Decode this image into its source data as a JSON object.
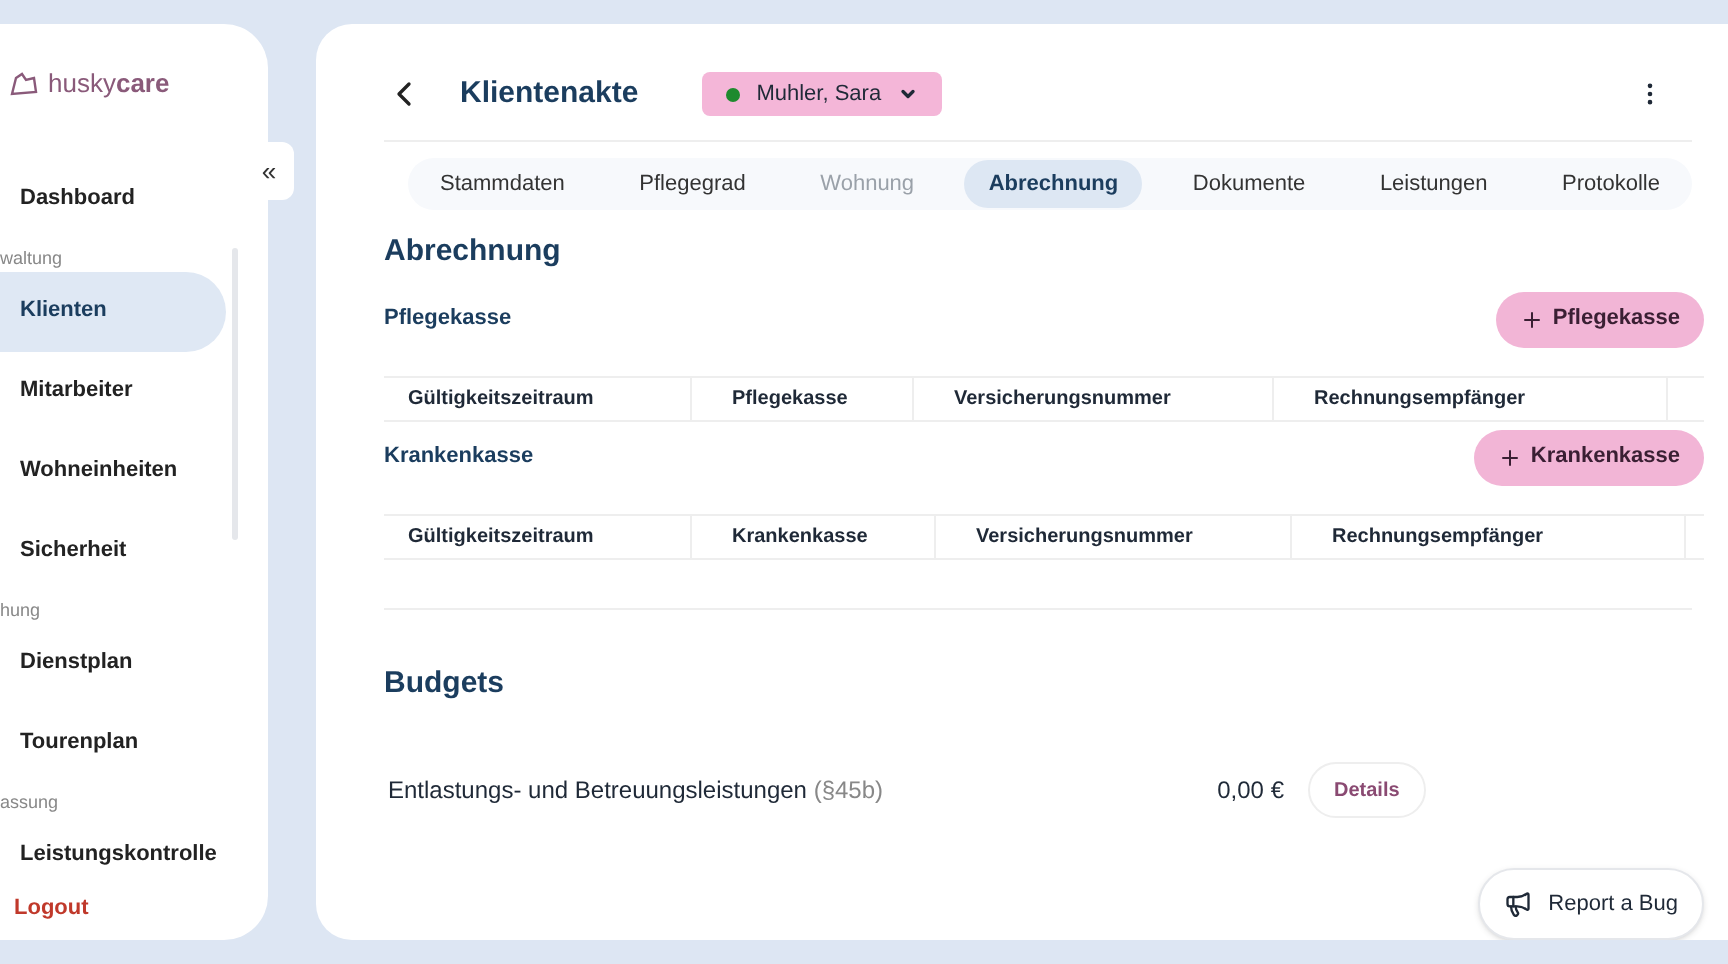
{
  "sidebar": {
    "logo": {
      "prefix": "husky",
      "suffix": "care"
    },
    "items": [
      {
        "kind": "item",
        "label": "Dashboard",
        "selected": false
      },
      {
        "kind": "section",
        "label": "waltung"
      },
      {
        "kind": "item",
        "label": "Klienten",
        "selected": true
      },
      {
        "kind": "item",
        "label": "Mitarbeiter",
        "selected": false
      },
      {
        "kind": "item",
        "label": "Wohneinheiten",
        "selected": false
      },
      {
        "kind": "item",
        "label": "Sicherheit",
        "selected": false
      },
      {
        "kind": "section",
        "label": "hung"
      },
      {
        "kind": "item",
        "label": "Dienstplan",
        "selected": false
      },
      {
        "kind": "item",
        "label": "Tourenplan",
        "selected": false
      },
      {
        "kind": "section",
        "label": "assung"
      },
      {
        "kind": "item",
        "label": "Leistungskontrolle",
        "selected": false
      }
    ],
    "logout": "Logout",
    "collapse": "«"
  },
  "header": {
    "title": "Klientenakte",
    "client": {
      "name": "Muhler, Sara",
      "color": "#1e8a2e"
    }
  },
  "tabs": [
    {
      "label": "Stammdaten",
      "selected": false,
      "disabled": false
    },
    {
      "label": "Pflegegrad",
      "selected": false,
      "disabled": false
    },
    {
      "label": "Wohnung",
      "selected": false,
      "disabled": true
    },
    {
      "label": "Abrechnung",
      "selected": true,
      "disabled": false
    },
    {
      "label": "Dokumente",
      "selected": false,
      "disabled": false
    },
    {
      "label": "Leistungen",
      "selected": false,
      "disabled": false
    },
    {
      "label": "Protokolle",
      "selected": false,
      "disabled": false
    }
  ],
  "section_title": "Abrechnung",
  "groups": [
    {
      "title": "Pflegekasse",
      "button": "Pflegekasse",
      "columns": [
        "Gültigkeitszeitraum",
        "Pflegekasse",
        "Versicherungsnummer",
        "Rechnungsempfänger"
      ]
    },
    {
      "title": "Krankenkasse",
      "button": "Krankenkasse",
      "columns": [
        "Gültigkeitszeitraum",
        "Krankenkasse",
        "Versicherungsnummer",
        "Rechnungsempfänger"
      ]
    }
  ],
  "budgets": {
    "title": "Budgets",
    "rows": [
      {
        "label": "Entlastungs- und Betreuungsleistungen",
        "note": "(§45b)",
        "amount": "0,00 €",
        "button": "Details"
      }
    ]
  },
  "report_bug": "Report a Bug"
}
